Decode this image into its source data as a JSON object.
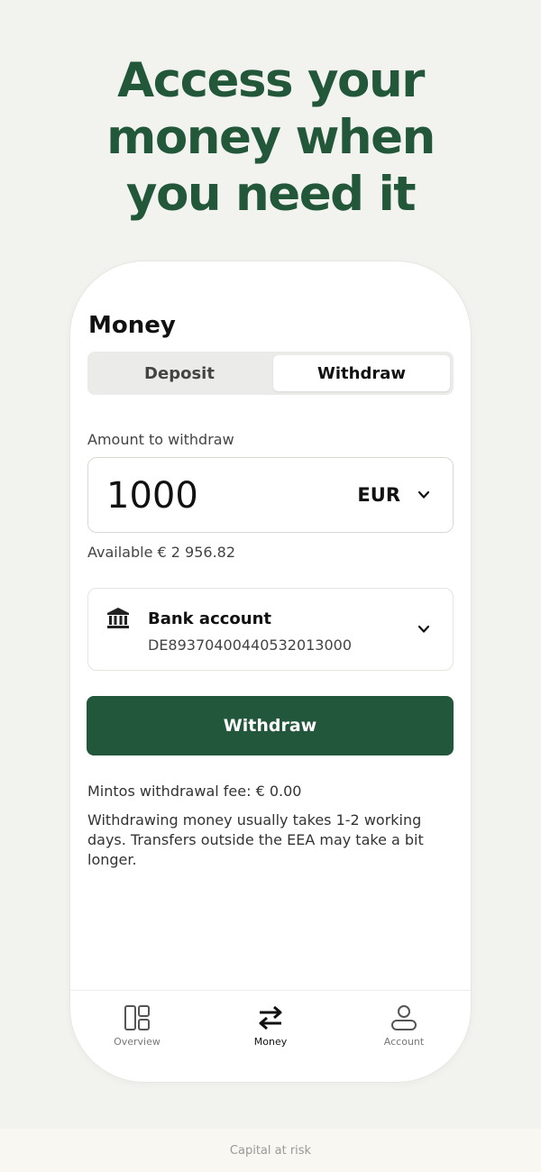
{
  "headline": {
    "line1": "Access your",
    "line2": "money when",
    "line3": "you need it"
  },
  "screen": {
    "title": "Money",
    "tabs": [
      {
        "label": "Deposit",
        "selected": false
      },
      {
        "label": "Withdraw",
        "selected": true
      }
    ],
    "amount_label": "Amount to withdraw",
    "amount_value": "1000",
    "currency": "EUR",
    "available": "Available € 2 956.82",
    "bank": {
      "name": "Bank account",
      "iban": "DE89370400440532013000",
      "icon": "bank-icon"
    },
    "withdraw_button": "Withdraw",
    "fee": "Mintos withdrawal fee: € 0.00",
    "info": "Withdrawing money usually takes 1-2 working days. Transfers outside the EEA may take a bit longer."
  },
  "nav": {
    "items": [
      {
        "label": "Overview",
        "icon": "overview-icon",
        "active": false
      },
      {
        "label": "Money",
        "icon": "transfer-arrows-icon",
        "active": true
      },
      {
        "label": "Account",
        "icon": "user-icon",
        "active": false
      }
    ]
  },
  "footer": {
    "text": "Capital at risk"
  },
  "colors": {
    "brand_green": "#23573c",
    "headline_green": "#22573a",
    "background": "#f2f2ef"
  }
}
